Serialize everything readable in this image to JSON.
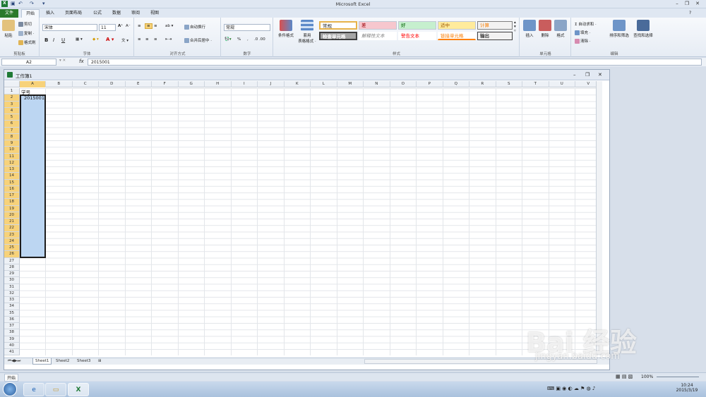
{
  "app": {
    "title": "Microsoft Excel"
  },
  "tabs": [
    "文件",
    "开始",
    "插入",
    "页面布局",
    "公式",
    "数据",
    "审阅",
    "视图"
  ],
  "clipboard": {
    "paste": "粘贴",
    "cut": "剪切",
    "copy": "复制 ·",
    "format_painter": "格式刷",
    "label": "剪贴板"
  },
  "font": {
    "name": "宋体",
    "size": "11",
    "bold": "B",
    "italic": "I",
    "underline": "U",
    "label": "字体"
  },
  "alignment": {
    "wrap": "自动换行",
    "merge": "合并后居中 ·",
    "label": "对齐方式"
  },
  "number": {
    "format": "常规",
    "percent": "%",
    "comma": ",",
    "label": "数字"
  },
  "styles": {
    "conditional": "条件格式",
    "table": "套用",
    "table2": "表格格式 ·",
    "normal": "常规",
    "bad": "差",
    "good": "好",
    "neutral": "适中",
    "calc": "计算",
    "check": "检查单元格",
    "explain": "解释性文本",
    "warn": "警告文本",
    "link": "链接单元格",
    "output": "输出",
    "label": "样式"
  },
  "cells_group": {
    "insert": "插入",
    "delete": "删除",
    "format": "格式",
    "label": "单元格"
  },
  "editing": {
    "autosum": "Σ 自动求和 ·",
    "fill": "填充 ·",
    "clear": "清除 ·",
    "sort": "排序和筛选",
    "find": "查找和选择",
    "label": "编辑"
  },
  "formula_bar": {
    "name_box": "A2",
    "fx": "fx",
    "value": "2015001"
  },
  "workbook": {
    "title": "工作簿1"
  },
  "columns": [
    "A",
    "B",
    "C",
    "D",
    "E",
    "F",
    "G",
    "H",
    "I",
    "J",
    "K",
    "L",
    "M",
    "N",
    "O",
    "P",
    "Q",
    "R",
    "S",
    "T",
    "U",
    "V"
  ],
  "rows": [
    "1",
    "2",
    "3",
    "4",
    "5",
    "6",
    "7",
    "8",
    "9",
    "10",
    "11",
    "12",
    "13",
    "14",
    "15",
    "16",
    "17",
    "18",
    "19",
    "20",
    "21",
    "22",
    "23",
    "24",
    "25",
    "26",
    "27",
    "28",
    "29",
    "30",
    "31",
    "32",
    "33",
    "34",
    "35",
    "36",
    "37",
    "38",
    "39",
    "40",
    "41"
  ],
  "cells": {
    "a1": "学号",
    "a2": "2015001"
  },
  "sheets": [
    "Sheet1",
    "Sheet2",
    "Sheet3"
  ],
  "status": {
    "ready": "开始",
    "zoom": "100%"
  },
  "clock": {
    "time": "10:24",
    "date": "2015/3/19"
  },
  "watermark": {
    "brand": "Bai 经验",
    "url": "jingyan.baidu.com"
  }
}
